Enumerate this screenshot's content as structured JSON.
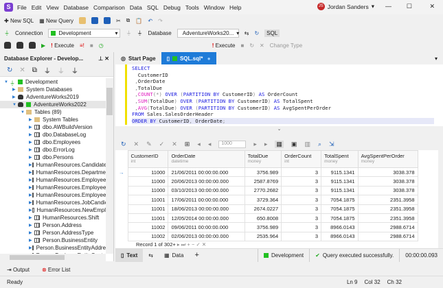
{
  "app": {
    "logo": "S",
    "menu": [
      "File",
      "Edit",
      "View",
      "Database",
      "Comparison",
      "Data",
      "SQL",
      "Debug",
      "Tools",
      "Window",
      "Help"
    ],
    "user": "Jordan Sanders",
    "user_initials": "JS"
  },
  "toolbar1": {
    "new_sql": "New SQL",
    "new_query": "New Query"
  },
  "toolbar2": {
    "connection_label": "Connection",
    "connection_value": "Development",
    "database_label": "Database",
    "database_value": "AdventureWorks20..."
  },
  "toolbar3": {
    "execute": "Execute",
    "execute2": "Execute",
    "change_type": "Change Type"
  },
  "explorer": {
    "title": "Database Explorer - Develop...",
    "items": [
      {
        "label": "Development",
        "level": 0,
        "icon": "connection",
        "exp": "open"
      },
      {
        "label": "System Databases",
        "level": 1,
        "icon": "folder",
        "exp": "closed"
      },
      {
        "label": "AdventureWorks2019",
        "level": 1,
        "icon": "database",
        "exp": "closed"
      },
      {
        "label": "AdventureWorks2022",
        "level": 1,
        "icon": "database",
        "exp": "open"
      },
      {
        "label": "Tables (89)",
        "level": 2,
        "icon": "folder",
        "exp": "open"
      },
      {
        "label": "System Tables",
        "level": 3,
        "icon": "folder",
        "exp": "closed"
      },
      {
        "label": "dbo.AWBuildVersion",
        "level": 3,
        "icon": "table",
        "exp": "closed"
      },
      {
        "label": "dbo.DatabaseLog",
        "level": 3,
        "icon": "table",
        "exp": "closed"
      },
      {
        "label": "dbo.Employees",
        "level": 3,
        "icon": "table",
        "exp": "closed"
      },
      {
        "label": "dbo.ErrorLog",
        "level": 3,
        "icon": "table",
        "exp": "closed"
      },
      {
        "label": "dbo.Persons",
        "level": 3,
        "icon": "table",
        "exp": "closed"
      },
      {
        "label": "HumanResources.Candidate",
        "level": 3,
        "icon": "table",
        "exp": "closed"
      },
      {
        "label": "HumanResources.Departme",
        "level": 3,
        "icon": "table",
        "exp": "closed"
      },
      {
        "label": "HumanResources.Employee",
        "level": 3,
        "icon": "table",
        "exp": "closed"
      },
      {
        "label": "HumanResources.EmployeeI",
        "level": 3,
        "icon": "table",
        "exp": "closed"
      },
      {
        "label": "HumanResources.EmployeeI",
        "level": 3,
        "icon": "table",
        "exp": "closed"
      },
      {
        "label": "HumanResources.JobCandic",
        "level": 3,
        "icon": "table",
        "exp": "closed"
      },
      {
        "label": "HumanResources.NewEmpl",
        "level": 3,
        "icon": "table",
        "exp": "closed"
      },
      {
        "label": "HumanResources.Shift",
        "level": 3,
        "icon": "table",
        "exp": "closed"
      },
      {
        "label": "Person.Address",
        "level": 3,
        "icon": "table",
        "exp": "closed"
      },
      {
        "label": "Person.AddressType",
        "level": 3,
        "icon": "table",
        "exp": "closed"
      },
      {
        "label": "Person.BusinessEntity",
        "level": 3,
        "icon": "table",
        "exp": "closed"
      },
      {
        "label": "Person.BusinessEntityAddre",
        "level": 3,
        "icon": "table",
        "exp": "closed"
      },
      {
        "label": "Person.BusinessEntityConta",
        "level": 3,
        "icon": "table",
        "exp": "closed"
      }
    ]
  },
  "tabs": [
    {
      "label": "Start Page"
    },
    {
      "label": "SQL.sql*"
    }
  ],
  "editor": {
    "lines": [
      [
        [
          "kw",
          "SELECT"
        ]
      ],
      [
        [
          "",
          "  CustomerID"
        ]
      ],
      [
        [
          "gr",
          " ,"
        ],
        [
          "",
          "OrderDate"
        ]
      ],
      [
        [
          "gr",
          " ,"
        ],
        [
          "",
          "TotalDue"
        ]
      ],
      [
        [
          "gr",
          " ,"
        ],
        [
          "fn",
          "COUNT"
        ],
        [
          "gr",
          "(*)"
        ],
        [
          "kw",
          " OVER "
        ],
        [
          "gr",
          "("
        ],
        [
          "kw",
          "PARTITION BY "
        ],
        [
          "",
          "CustomerID"
        ],
        [
          "gr",
          ")"
        ],
        [
          "kw",
          " AS "
        ],
        [
          "",
          "OrderCount"
        ]
      ],
      [
        [
          "gr",
          " ,"
        ],
        [
          "fn",
          "SUM"
        ],
        [
          "gr",
          "("
        ],
        [
          "",
          "TotalDue"
        ],
        [
          "gr",
          ")"
        ],
        [
          "kw",
          " OVER "
        ],
        [
          "gr",
          "("
        ],
        [
          "kw",
          "PARTITION BY "
        ],
        [
          "",
          "CustomerID"
        ],
        [
          "gr",
          ")"
        ],
        [
          "kw",
          " AS "
        ],
        [
          "",
          "TotalSpent"
        ]
      ],
      [
        [
          "gr",
          " ,"
        ],
        [
          "fn",
          "AVG"
        ],
        [
          "gr",
          "("
        ],
        [
          "",
          "TotalDue"
        ],
        [
          "gr",
          ")"
        ],
        [
          "kw",
          " OVER "
        ],
        [
          "gr",
          "("
        ],
        [
          "kw",
          "PARTITION BY "
        ],
        [
          "",
          "CustomerID"
        ],
        [
          "gr",
          ")"
        ],
        [
          "kw",
          " AS "
        ],
        [
          "",
          "AvgSpentPerOrder"
        ]
      ],
      [
        [
          "kw",
          "FROM "
        ],
        [
          "",
          "Sales.SalesOrderHeader"
        ]
      ],
      [
        [
          "kw",
          "ORDER BY "
        ],
        [
          "",
          "CustomerID"
        ],
        [
          "gr",
          ", "
        ],
        [
          "",
          "OrderDate"
        ],
        [
          "gr",
          ";"
        ]
      ]
    ]
  },
  "results": {
    "limit": "1000",
    "columns": [
      {
        "name": "CustomerID",
        "type": "int"
      },
      {
        "name": "OrderDate",
        "type": "datetime"
      },
      {
        "name": "TotalDue",
        "type": "money"
      },
      {
        "name": "OrderCount",
        "type": "int"
      },
      {
        "name": "TotalSpent",
        "type": "money"
      },
      {
        "name": "AvgSpentPerOrder",
        "type": "money"
      }
    ],
    "rows": [
      [
        "11000",
        "21/06/2011 00:00:00.000",
        "3756.989",
        "3",
        "9115.1341",
        "3038.378"
      ],
      [
        "11000",
        "20/06/2013 00:00:00.000",
        "2587.8769",
        "3",
        "9115.1341",
        "3038.378"
      ],
      [
        "11000",
        "03/10/2013 00:00:00.000",
        "2770.2682",
        "3",
        "9115.1341",
        "3038.378"
      ],
      [
        "11001",
        "17/06/2011 00:00:00.000",
        "3729.364",
        "3",
        "7054.1875",
        "2351.3958"
      ],
      [
        "11001",
        "18/06/2013 00:00:00.000",
        "2674.0227",
        "3",
        "7054.1875",
        "2351.3958"
      ],
      [
        "11001",
        "12/05/2014 00:00:00.000",
        "650.8008",
        "3",
        "7054.1875",
        "2351.3958"
      ],
      [
        "11002",
        "09/06/2011 00:00:00.000",
        "3756.989",
        "3",
        "8966.0143",
        "2988.6714"
      ],
      [
        "11002",
        "02/06/2013 00:00:00.000",
        "2535.964",
        "3",
        "8966.0143",
        "2988.6714"
      ]
    ],
    "record": "Record 1 of 302+"
  },
  "bottom_tabs": {
    "text": "Text",
    "data": "Data",
    "connection": "Development",
    "message": "Query executed successfully.",
    "time": "00:00:00.093"
  },
  "output_bar": {
    "output": "Output",
    "error_list": "Error List"
  },
  "status": {
    "ready": "Ready",
    "ln": "Ln 9",
    "col": "Col 32",
    "ch": "Ch 32"
  }
}
